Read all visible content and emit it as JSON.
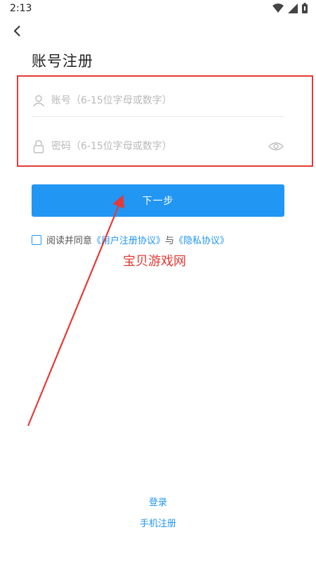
{
  "status_bar": {
    "time": "2:13",
    "icons": [
      "wifi-icon",
      "signal-icon",
      "battery-icon"
    ]
  },
  "header": {
    "back_icon": "back-arrow-icon",
    "title": "账号注册"
  },
  "form": {
    "account": {
      "icon": "user-icon",
      "placeholder": "账号（6-15位字母或数字）",
      "value": ""
    },
    "password": {
      "icon": "lock-icon",
      "placeholder": "密码（6-15位字母或数字）",
      "value": "",
      "toggle_icon": "eye-icon"
    },
    "next_label": "下一步"
  },
  "agreement": {
    "checked": false,
    "prefix": "阅读并同意",
    "user_agreement": "《用户注册协议》",
    "conjunction": "与",
    "privacy_policy": "《隐私协议》"
  },
  "watermark": "宝贝游戏网",
  "footer": {
    "login_label": "登录",
    "phone_register_label": "手机注册"
  },
  "colors": {
    "accent": "#2196f3",
    "annotation": "#e53935",
    "placeholder": "#b9b9b9"
  }
}
